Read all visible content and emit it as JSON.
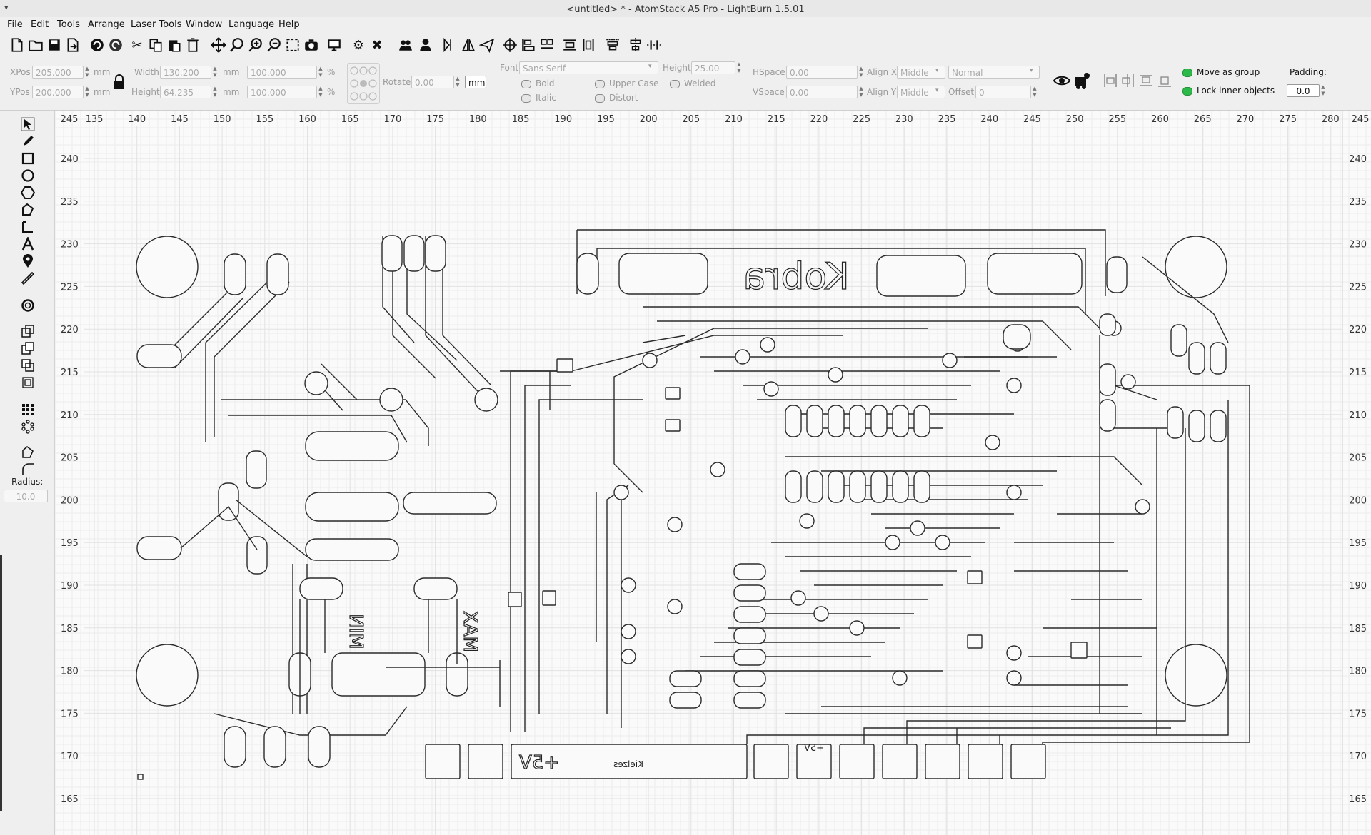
{
  "window": {
    "title": "<untitled> * - AtomStack A5 Pro - LightBurn 1.5.01"
  },
  "menu": [
    "File",
    "Edit",
    "Tools",
    "Arrange",
    "Laser Tools",
    "Window",
    "Language",
    "Help"
  ],
  "toolbar": {
    "icons": [
      "new-file-icon",
      "open-file-icon",
      "save-icon",
      "save-as-icon",
      "undo-icon",
      "redo-icon",
      "cut-icon",
      "copy-icon",
      "paste-icon",
      "delete-icon",
      "move-icon",
      "zoom-in-icon",
      "zoom-fit-icon",
      "zoom-out-icon",
      "frame-icon",
      "camera-icon",
      "monitor-icon",
      "settings-icon",
      "tools-icon",
      "group-icon",
      "user-icon",
      "mirror-h-icon",
      "mirror-v-icon",
      "send-icon",
      "target-icon",
      "align-left-icon",
      "align-center-icon",
      "distribute-icon",
      "distribute-v-icon",
      "align-top-icon",
      "align-middle-icon"
    ]
  },
  "shape_props": {
    "xpos_label": "XPos",
    "xpos": "205.000",
    "ypos_label": "YPos",
    "ypos": "200.000",
    "unit": "mm",
    "width_label": "Width",
    "width": "130.200",
    "height_label": "Height",
    "height": "64.235",
    "scale_w": "100.000",
    "scale_h": "100.000",
    "percent": "%",
    "rotate_label": "Rotate",
    "rotate": "0.00",
    "rotate_unit": "mm"
  },
  "text_props": {
    "font_label": "Font",
    "font": "Sans Serif",
    "height_label": "Height",
    "height": "25.00",
    "hspace_label": "HSpace",
    "hspace": "0.00",
    "vspace_label": "VSpace",
    "vspace": "0.00",
    "alignx_label": "Align X",
    "alignx": "Middle",
    "aligny_label": "Align Y",
    "aligny": "Middle",
    "style": "Normal",
    "offset_label": "Offset",
    "offset": "0",
    "bold": "Bold",
    "italic": "Italic",
    "upper": "Upper Case",
    "distort": "Distort",
    "welded": "Welded"
  },
  "group_opts": {
    "move_as_group": "Move as group",
    "lock_inner": "Lock inner objects",
    "padding_label": "Padding:",
    "padding": "0.0"
  },
  "left_tools": {
    "radius_label": "Radius:",
    "radius": "10.0"
  },
  "ruler": {
    "top": [
      "245",
      "135",
      "140",
      "145",
      "150",
      "155",
      "160",
      "165",
      "170",
      "175",
      "180",
      "185",
      "190",
      "195",
      "200",
      "205",
      "210",
      "215",
      "220",
      "225",
      "230",
      "235",
      "240",
      "245",
      "250",
      "255",
      "260",
      "265",
      "270",
      "275",
      "280",
      "245"
    ],
    "left": [
      "240",
      "235",
      "230",
      "225",
      "220",
      "215",
      "210",
      "205",
      "200",
      "195",
      "190",
      "185",
      "180",
      "175",
      "170",
      "165"
    ]
  },
  "pcb": {
    "labels": {
      "kobra": "Kobra",
      "min": "MIN",
      "max": "MAX",
      "v5_big": "+5V",
      "v5_small": "+5V",
      "kielzes": "Kielzes"
    }
  },
  "colors": {
    "canvas": "#fafafa",
    "trace": "#2b2b2b",
    "toggle_on": "#2db84a"
  }
}
